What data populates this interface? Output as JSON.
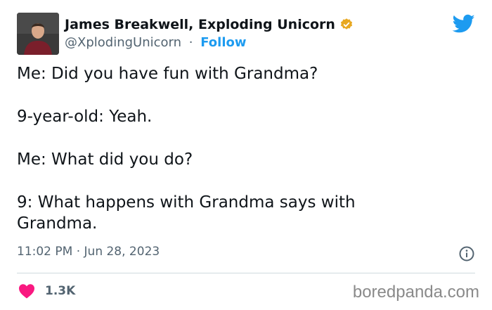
{
  "author": {
    "display_name": "James Breakwell, Exploding Unicorn",
    "handle": "@XplodingUnicorn",
    "separator": "·",
    "follow_label": "Follow",
    "verified_color": "#e8a821"
  },
  "tweet": {
    "lines": [
      "Me: Did you have fun with Grandma?",
      "9-year-old: Yeah.",
      "Me: What did you do?",
      "9: What happens with Grandma says with Grandma."
    ],
    "timestamp": "11:02 PM · Jun 28, 2023"
  },
  "engagement": {
    "likes": "1.3K",
    "heart_color": "#f91880"
  },
  "brand": {
    "twitter_blue": "#1d9bf0",
    "icon": "twitter-bird-icon"
  },
  "watermark": "boredpanda.com"
}
